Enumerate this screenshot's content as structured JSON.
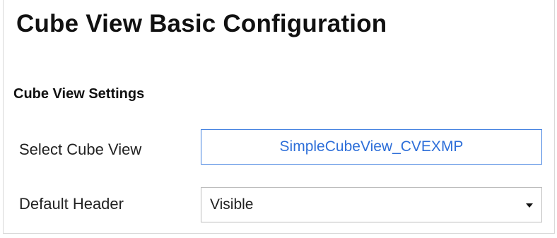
{
  "page": {
    "title": "Cube View Basic Configuration"
  },
  "settings": {
    "section_title": "Cube View Settings",
    "select_cube_view": {
      "label": "Select Cube View",
      "value": "SimpleCubeView_CVEXMP"
    },
    "default_header": {
      "label": "Default Header",
      "value": "Visible",
      "icon": "chevron-down-icon"
    }
  },
  "colors": {
    "link_blue": "#2e6fd9",
    "field_border_active": "#3f7fe0",
    "field_border": "#bdbdbd"
  }
}
